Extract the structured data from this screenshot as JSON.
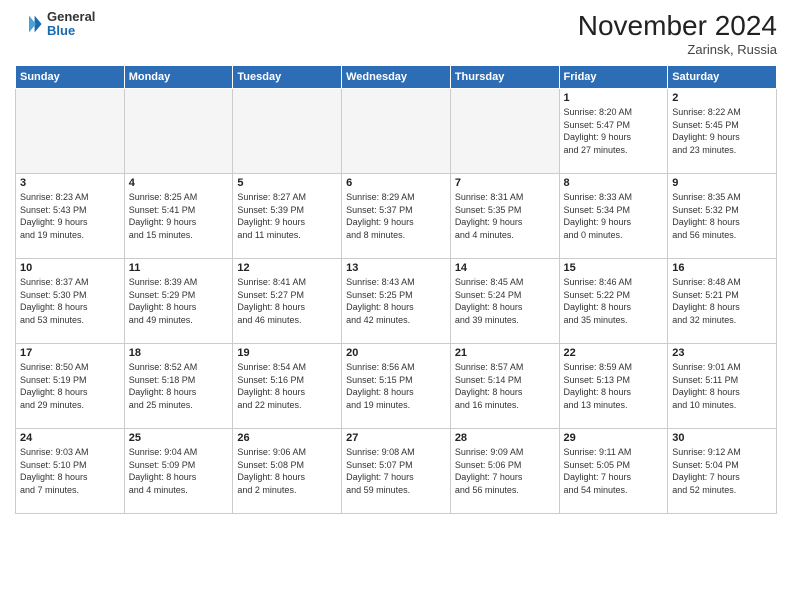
{
  "header": {
    "logo_general": "General",
    "logo_blue": "Blue",
    "month_title": "November 2024",
    "location": "Zarinsk, Russia"
  },
  "weekdays": [
    "Sunday",
    "Monday",
    "Tuesday",
    "Wednesday",
    "Thursday",
    "Friday",
    "Saturday"
  ],
  "weeks": [
    [
      {
        "day": "",
        "info": ""
      },
      {
        "day": "",
        "info": ""
      },
      {
        "day": "",
        "info": ""
      },
      {
        "day": "",
        "info": ""
      },
      {
        "day": "",
        "info": ""
      },
      {
        "day": "1",
        "info": "Sunrise: 8:20 AM\nSunset: 5:47 PM\nDaylight: 9 hours\nand 27 minutes."
      },
      {
        "day": "2",
        "info": "Sunrise: 8:22 AM\nSunset: 5:45 PM\nDaylight: 9 hours\nand 23 minutes."
      }
    ],
    [
      {
        "day": "3",
        "info": "Sunrise: 8:23 AM\nSunset: 5:43 PM\nDaylight: 9 hours\nand 19 minutes."
      },
      {
        "day": "4",
        "info": "Sunrise: 8:25 AM\nSunset: 5:41 PM\nDaylight: 9 hours\nand 15 minutes."
      },
      {
        "day": "5",
        "info": "Sunrise: 8:27 AM\nSunset: 5:39 PM\nDaylight: 9 hours\nand 11 minutes."
      },
      {
        "day": "6",
        "info": "Sunrise: 8:29 AM\nSunset: 5:37 PM\nDaylight: 9 hours\nand 8 minutes."
      },
      {
        "day": "7",
        "info": "Sunrise: 8:31 AM\nSunset: 5:35 PM\nDaylight: 9 hours\nand 4 minutes."
      },
      {
        "day": "8",
        "info": "Sunrise: 8:33 AM\nSunset: 5:34 PM\nDaylight: 9 hours\nand 0 minutes."
      },
      {
        "day": "9",
        "info": "Sunrise: 8:35 AM\nSunset: 5:32 PM\nDaylight: 8 hours\nand 56 minutes."
      }
    ],
    [
      {
        "day": "10",
        "info": "Sunrise: 8:37 AM\nSunset: 5:30 PM\nDaylight: 8 hours\nand 53 minutes."
      },
      {
        "day": "11",
        "info": "Sunrise: 8:39 AM\nSunset: 5:29 PM\nDaylight: 8 hours\nand 49 minutes."
      },
      {
        "day": "12",
        "info": "Sunrise: 8:41 AM\nSunset: 5:27 PM\nDaylight: 8 hours\nand 46 minutes."
      },
      {
        "day": "13",
        "info": "Sunrise: 8:43 AM\nSunset: 5:25 PM\nDaylight: 8 hours\nand 42 minutes."
      },
      {
        "day": "14",
        "info": "Sunrise: 8:45 AM\nSunset: 5:24 PM\nDaylight: 8 hours\nand 39 minutes."
      },
      {
        "day": "15",
        "info": "Sunrise: 8:46 AM\nSunset: 5:22 PM\nDaylight: 8 hours\nand 35 minutes."
      },
      {
        "day": "16",
        "info": "Sunrise: 8:48 AM\nSunset: 5:21 PM\nDaylight: 8 hours\nand 32 minutes."
      }
    ],
    [
      {
        "day": "17",
        "info": "Sunrise: 8:50 AM\nSunset: 5:19 PM\nDaylight: 8 hours\nand 29 minutes."
      },
      {
        "day": "18",
        "info": "Sunrise: 8:52 AM\nSunset: 5:18 PM\nDaylight: 8 hours\nand 25 minutes."
      },
      {
        "day": "19",
        "info": "Sunrise: 8:54 AM\nSunset: 5:16 PM\nDaylight: 8 hours\nand 22 minutes."
      },
      {
        "day": "20",
        "info": "Sunrise: 8:56 AM\nSunset: 5:15 PM\nDaylight: 8 hours\nand 19 minutes."
      },
      {
        "day": "21",
        "info": "Sunrise: 8:57 AM\nSunset: 5:14 PM\nDaylight: 8 hours\nand 16 minutes."
      },
      {
        "day": "22",
        "info": "Sunrise: 8:59 AM\nSunset: 5:13 PM\nDaylight: 8 hours\nand 13 minutes."
      },
      {
        "day": "23",
        "info": "Sunrise: 9:01 AM\nSunset: 5:11 PM\nDaylight: 8 hours\nand 10 minutes."
      }
    ],
    [
      {
        "day": "24",
        "info": "Sunrise: 9:03 AM\nSunset: 5:10 PM\nDaylight: 8 hours\nand 7 minutes."
      },
      {
        "day": "25",
        "info": "Sunrise: 9:04 AM\nSunset: 5:09 PM\nDaylight: 8 hours\nand 4 minutes."
      },
      {
        "day": "26",
        "info": "Sunrise: 9:06 AM\nSunset: 5:08 PM\nDaylight: 8 hours\nand 2 minutes."
      },
      {
        "day": "27",
        "info": "Sunrise: 9:08 AM\nSunset: 5:07 PM\nDaylight: 7 hours\nand 59 minutes."
      },
      {
        "day": "28",
        "info": "Sunrise: 9:09 AM\nSunset: 5:06 PM\nDaylight: 7 hours\nand 56 minutes."
      },
      {
        "day": "29",
        "info": "Sunrise: 9:11 AM\nSunset: 5:05 PM\nDaylight: 7 hours\nand 54 minutes."
      },
      {
        "day": "30",
        "info": "Sunrise: 9:12 AM\nSunset: 5:04 PM\nDaylight: 7 hours\nand 52 minutes."
      }
    ]
  ]
}
